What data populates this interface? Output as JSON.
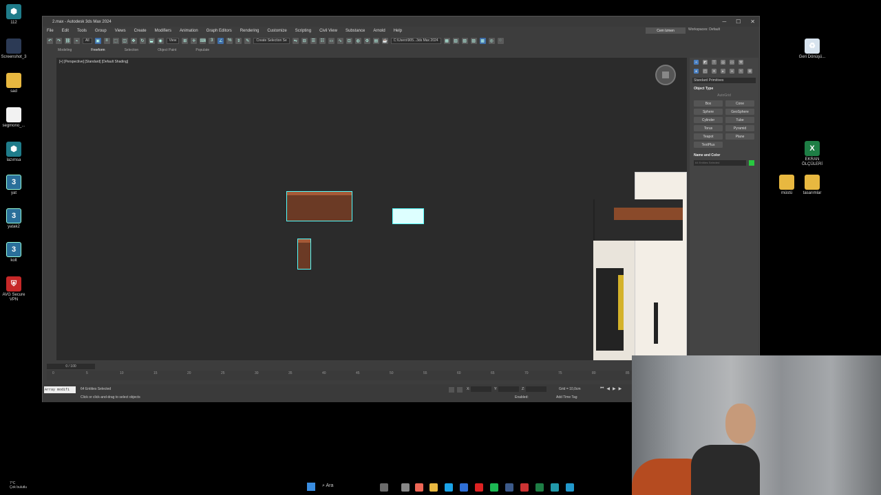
{
  "desktop": {
    "left_icons": [
      {
        "label": "112",
        "icon": "3dsmax-app-icon",
        "glyph": "⬢"
      },
      {
        "label": "Screenshot_3",
        "icon": "image-file-icon",
        "glyph": ""
      },
      {
        "label": "sad",
        "icon": "folder-icon",
        "glyph": ""
      },
      {
        "label": "segmono_...",
        "icon": "document-icon",
        "glyph": ""
      },
      {
        "label": "lazımsa",
        "icon": "3dsmax-app-icon",
        "glyph": "⬢"
      },
      {
        "label": "yat",
        "icon": "max-file-icon",
        "glyph": "3"
      },
      {
        "label": "yatak2",
        "icon": "max-file-icon",
        "glyph": "3"
      },
      {
        "label": "kolt",
        "icon": "max-file-icon",
        "glyph": "3"
      },
      {
        "label": "AVG Secure VPN",
        "icon": "vpn-app-icon",
        "glyph": "⛨"
      }
    ],
    "right_icons": [
      {
        "label": "Geri Dönüşü...",
        "icon": "recycle-bin-icon",
        "glyph": "♻"
      },
      {
        "label": "EKRAN ÖLÇÜLERİ",
        "icon": "excel-file-icon",
        "glyph": "X"
      },
      {
        "label": "müstü",
        "icon": "folder-icon",
        "glyph": ""
      },
      {
        "label": "tasarımlar",
        "icon": "folder-icon",
        "glyph": ""
      }
    ],
    "weather": {
      "temp": "7°C",
      "desc": "Çok bulutlu"
    }
  },
  "window": {
    "title": "2.max - Autodesk 3ds Max 2024",
    "controls": [
      "─",
      "☐",
      "✕"
    ]
  },
  "menu": [
    "File",
    "Edit",
    "Tools",
    "Group",
    "Views",
    "Create",
    "Modifiers",
    "Animation",
    "Graph Editors",
    "Rendering",
    "Customize",
    "Scripting",
    "Civil View",
    "Substance",
    "Arnold",
    "Help"
  ],
  "signin_label": "Cem Izmen",
  "workspaces_label": "Workspaces:",
  "workspaces_value": "Default",
  "toolbar": {
    "filter_value": "All",
    "view_value": "View",
    "selection_set_placeholder": "Create Selection Se",
    "path_value": "C:\\Users\\905...3ds Max 2024"
  },
  "ribbon_tabs": [
    {
      "label": "Modeling",
      "active": false
    },
    {
      "label": "Freeform",
      "active": true
    },
    {
      "label": "Selection",
      "active": false
    },
    {
      "label": "Object Paint",
      "active": false
    },
    {
      "label": "Populate",
      "active": false
    }
  ],
  "viewport": {
    "label": "[+] [Perspective] [Standard] [Default Shading]"
  },
  "command_panel": {
    "category": "Standard Primitives",
    "rollout_object_type": "Object Type",
    "autogrid": "AutoGrid",
    "primitives": [
      "Box",
      "Cone",
      "Sphere",
      "GeoSphere",
      "Cylinder",
      "Tube",
      "Torus",
      "Pyramid",
      "Teapot",
      "Plane",
      "TextPlus"
    ],
    "rollout_name_color": "Name and Color",
    "name_value": "64 Entities Selected",
    "object_color": "#28c940"
  },
  "timeline": {
    "slider_label": "0 / 100",
    "ticks": [
      "0",
      "5",
      "10",
      "15",
      "20",
      "25",
      "30",
      "35",
      "40",
      "45",
      "50",
      "55",
      "60",
      "65",
      "70",
      "75",
      "80",
      "85"
    ]
  },
  "status": {
    "modifier": "Array modifi",
    "selected": "64 Entities Selected",
    "prompt": "Click or click-and-drag to select objects",
    "x_label": "X:",
    "y_label": "Y:",
    "z_label": "Z:",
    "grid": "Grid = 10,0cm",
    "enabled_label": "Enabled:",
    "add_time_tag": "Add Time Tag"
  },
  "taskbar": {
    "search_label": "Ara"
  },
  "colors": {
    "selection_outline": "#55ffff",
    "wood": "#6b3a25",
    "wood_top": "#a55a37"
  }
}
